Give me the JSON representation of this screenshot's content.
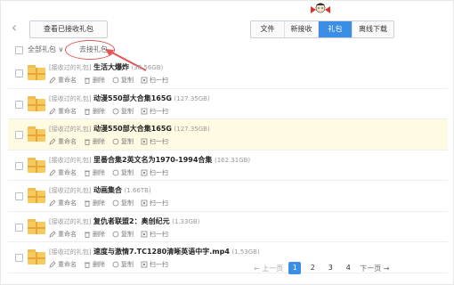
{
  "toolbar": {
    "view_received_label": "查看已接收礼包",
    "tabs": [
      {
        "label": "文件"
      },
      {
        "label": "新接收"
      },
      {
        "label": "礼包",
        "active": true
      },
      {
        "label": "离线下载"
      }
    ]
  },
  "filter": {
    "all_label": "全部礼包 ∨",
    "go_gift_label": "去接礼包"
  },
  "actions": {
    "rename": "重命名",
    "delete": "删除",
    "copy": "复制",
    "scan": "扫一扫"
  },
  "items": [
    {
      "tag": "[接收过的礼包]",
      "name": "生活大爆炸",
      "size": "(38.56GB)"
    },
    {
      "tag": "[接收过的礼包]",
      "name": "动漫550部大合集165G",
      "size": "(127.35GB)"
    },
    {
      "tag": "[接收过的礼包]",
      "name": "动漫550部大合集165G",
      "size": "(127.35GB)"
    },
    {
      "tag": "[接收过的礼包]",
      "name": "里番合集2英文名为1970-1994合集",
      "size": "(162.31GB)"
    },
    {
      "tag": "[接收过的礼包]",
      "name": "动画集合",
      "size": "(1.66TB)"
    },
    {
      "tag": "[接收过的礼包]",
      "name": "复仇者联盟2：奥创纪元",
      "size": "(1.33GB)"
    },
    {
      "tag": "[接收过的礼包]",
      "name": "速度与激情7.TC1280清晰英语中字.mp4",
      "size": "(1.53GB)"
    }
  ],
  "pagination": {
    "prev": "← 上一页",
    "pages": [
      "1",
      "2",
      "3",
      "4"
    ],
    "current": "1",
    "next": "下一页 →"
  },
  "colors": {
    "accent": "#3b8ee5",
    "highlight_row": "#fffbe3",
    "annotation": "#e35353",
    "folder": "#f7ca5d"
  }
}
